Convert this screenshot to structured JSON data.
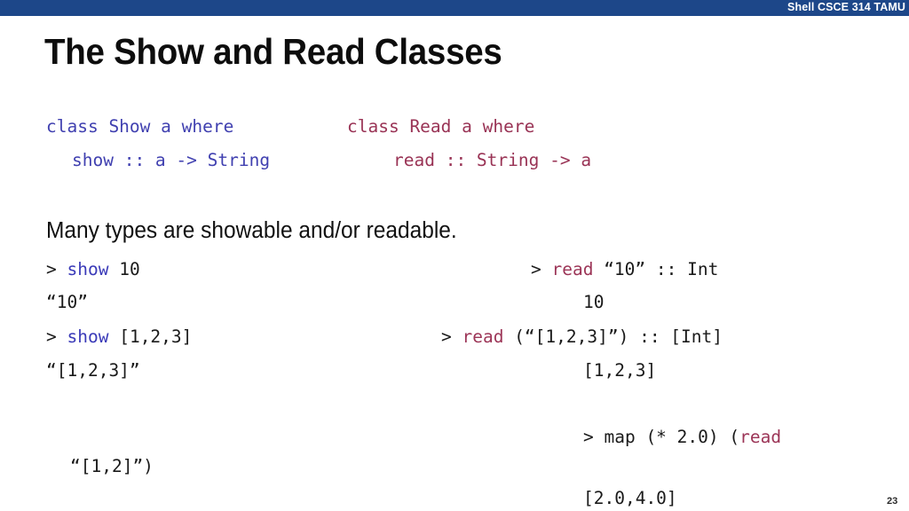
{
  "header": {
    "banner_title": "Shell CSCE 314 TAMU",
    "banner_color": "#1d4789"
  },
  "slide": {
    "title": "The Show and Read Classes",
    "page_number": "23"
  },
  "colors": {
    "show_blue": "#3a3ab8",
    "read_maroon": "#9c3557",
    "body_text": "#1a1a1a"
  },
  "class_declarations": {
    "show": {
      "line1": "class Show a where",
      "line2": "show :: a -> String"
    },
    "read": {
      "line1": "class Read a where",
      "line2": "read :: String -> a"
    }
  },
  "prose": {
    "line": "Many types are showable and/or readable."
  },
  "show_examples": [
    {
      "prompt": ">",
      "keyword": "show",
      "args": " 10",
      "output": "“10”"
    },
    {
      "prompt": ">",
      "keyword": "show",
      "args": " [1,2,3]",
      "output": "“[1,2,3]”"
    }
  ],
  "show_fragment": "“[1,2]”)",
  "read_examples": [
    {
      "prompt": "> ",
      "keyword": "read",
      "args": " “10” :: Int",
      "output": "10"
    },
    {
      "prompt": "> ",
      "keyword": "read",
      "args": " (“[1,2,3]”) :: [Int]",
      "output": "[1,2,3]"
    },
    {
      "prompt": "> map (* 2.0) (",
      "keyword": "read",
      "args": "",
      "output": "[2.0,4.0]"
    }
  ]
}
